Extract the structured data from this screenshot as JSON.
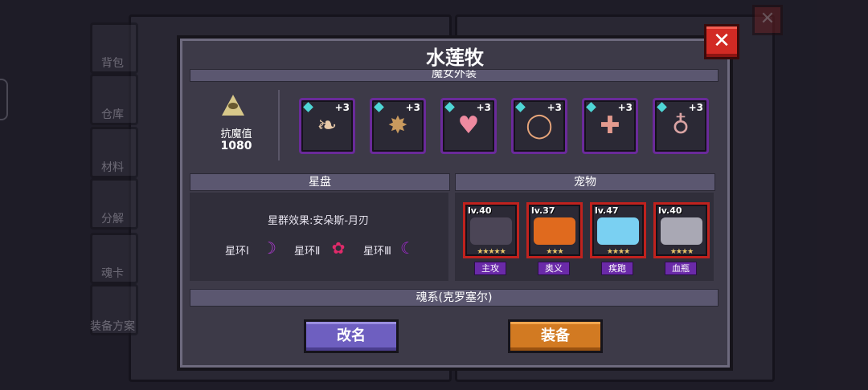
{
  "background": {
    "sidebar": [
      "背包",
      "仓库",
      "材料",
      "分解",
      "魂卡",
      "装备方案"
    ],
    "close_label": "✕"
  },
  "dialog": {
    "title": "水莲牧",
    "close_label": "✕",
    "sections": {
      "outfit": "魔女外装",
      "star_chart": "星盘",
      "pets": "宠物",
      "soul": "魂系(克罗塞尔)"
    },
    "resist": {
      "label": "抗魔值",
      "value": "1080"
    },
    "equipment": [
      {
        "icon": "horns-icon",
        "glyph": "❧",
        "color": "#e8c9a8",
        "bonus": "+3"
      },
      {
        "icon": "amulet-icon",
        "glyph": "✸",
        "color": "#c99a5e",
        "bonus": "+3"
      },
      {
        "icon": "heart-icon",
        "glyph": "♥",
        "color": "#ef8aa0",
        "bonus": "+3"
      },
      {
        "icon": "ring-icon",
        "glyph": "◯",
        "color": "#e7a57a",
        "bonus": "+3"
      },
      {
        "icon": "cross-icon",
        "glyph": "✚",
        "color": "#e39a8e",
        "bonus": "+3"
      },
      {
        "icon": "pouch-icon",
        "glyph": "♁",
        "color": "#d9a3a3",
        "bonus": "+3"
      }
    ],
    "star_effect": "星群效果:安朵斯-月刃",
    "rings": [
      {
        "label": "星环Ⅰ",
        "icon": "purple-crescent-icon",
        "glyph": "☽",
        "color": "#b43ad8"
      },
      {
        "label": "星环Ⅱ",
        "icon": "pink-flower-icon",
        "glyph": "✿",
        "color": "#e02a6a"
      },
      {
        "label": "星环Ⅲ",
        "icon": "purple-moon-icon",
        "glyph": "☾",
        "color": "#a22ad0"
      }
    ],
    "pets": [
      {
        "level": "lv.40",
        "stars": "★★★★★",
        "role": "主攻",
        "art": "#4b4556"
      },
      {
        "level": "lv.37",
        "stars": "★★★",
        "role": "奥义",
        "art": "#e06a1e"
      },
      {
        "level": "lv.47",
        "stars": "★★★★",
        "role": "疾跑",
        "art": "#7ad0f2"
      },
      {
        "level": "lv.40",
        "stars": "★★★★",
        "role": "血瓶",
        "art": "#a9a8b4"
      }
    ],
    "buttons": {
      "rename": "改名",
      "equip": "装备"
    }
  }
}
